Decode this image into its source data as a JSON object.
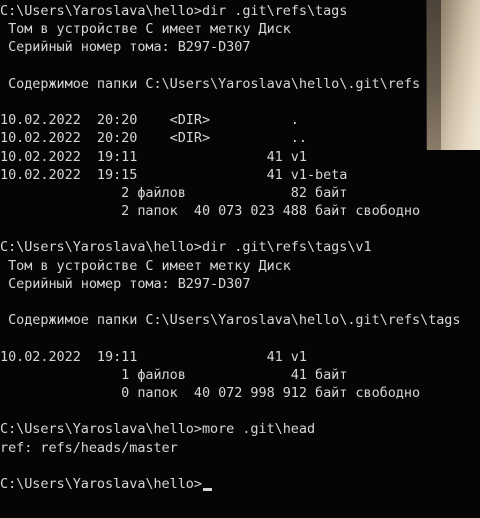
{
  "terminal": {
    "lines": [
      "C:\\Users\\Yaroslava\\hello>dir .git\\refs\\tags",
      " Том в устройстве C имеет метку Диск",
      " Серийный номер тома: B297-D307",
      "",
      " Содержимое папки C:\\Users\\Yaroslava\\hello\\.git\\refs",
      "",
      "10.02.2022  20:20    <DIR>          .",
      "10.02.2022  20:20    <DIR>          ..",
      "10.02.2022  19:11                41 v1",
      "10.02.2022  19:15                41 v1-beta",
      "               2 файлов             82 байт",
      "               2 папок  40 073 023 488 байт свободно",
      "",
      "C:\\Users\\Yaroslava\\hello>dir .git\\refs\\tags\\v1",
      " Том в устройстве C имеет метку Диск",
      " Серийный номер тома: B297-D307",
      "",
      " Содержимое папки C:\\Users\\Yaroslava\\hello\\.git\\refs\\tags",
      "",
      "10.02.2022  19:11                41 v1",
      "               1 файлов             41 байт",
      "               0 папок  40 072 998 912 байт свободно",
      "",
      "C:\\Users\\Yaroslava\\hello>more .git\\head",
      "ref: refs/heads/master",
      "",
      "C:\\Users\\Yaroslava\\hello>"
    ]
  }
}
